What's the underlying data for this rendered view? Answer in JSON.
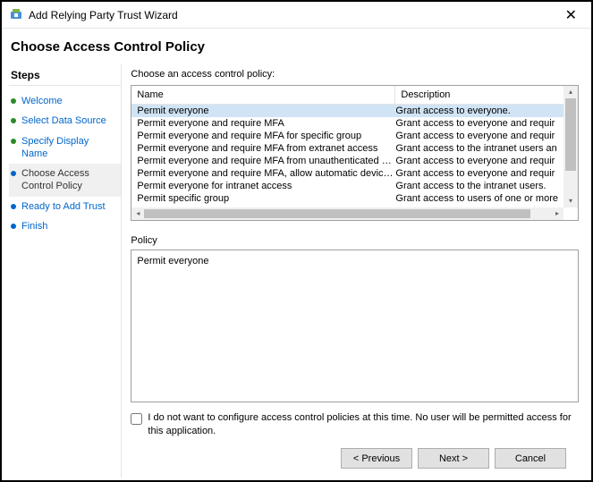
{
  "window": {
    "title": "Add Relying Party Trust Wizard",
    "close": "✕"
  },
  "header": {
    "title": "Choose Access Control Policy"
  },
  "sidebar": {
    "heading": "Steps",
    "items": [
      {
        "label": "Welcome"
      },
      {
        "label": "Select Data Source"
      },
      {
        "label": "Specify Display Name"
      },
      {
        "label": "Choose Access Control Policy"
      },
      {
        "label": "Ready to Add Trust"
      },
      {
        "label": "Finish"
      }
    ]
  },
  "main": {
    "prompt": "Choose an access control policy:",
    "columns": {
      "name": "Name",
      "description": "Description"
    },
    "rows": [
      {
        "name": "Permit everyone",
        "desc": "Grant access to everyone."
      },
      {
        "name": "Permit everyone and require MFA",
        "desc": "Grant access to everyone and requir"
      },
      {
        "name": "Permit everyone and require MFA for specific group",
        "desc": "Grant access to everyone and requir"
      },
      {
        "name": "Permit everyone and require MFA from extranet access",
        "desc": "Grant access to the intranet users an"
      },
      {
        "name": "Permit everyone and require MFA from unauthenticated devices",
        "desc": "Grant access to everyone and requir"
      },
      {
        "name": "Permit everyone and require MFA, allow automatic device registr...",
        "desc": "Grant access to everyone and requir"
      },
      {
        "name": "Permit everyone for intranet access",
        "desc": "Grant access to the intranet users."
      },
      {
        "name": "Permit specific group",
        "desc": "Grant access to users of one or more"
      }
    ],
    "policy_label": "Policy",
    "policy_text": "Permit everyone",
    "checkbox_label": "I do not want to configure access control policies at this time. No user will be permitted access for this application."
  },
  "buttons": {
    "previous": "< Previous",
    "next": "Next >",
    "cancel": "Cancel"
  }
}
